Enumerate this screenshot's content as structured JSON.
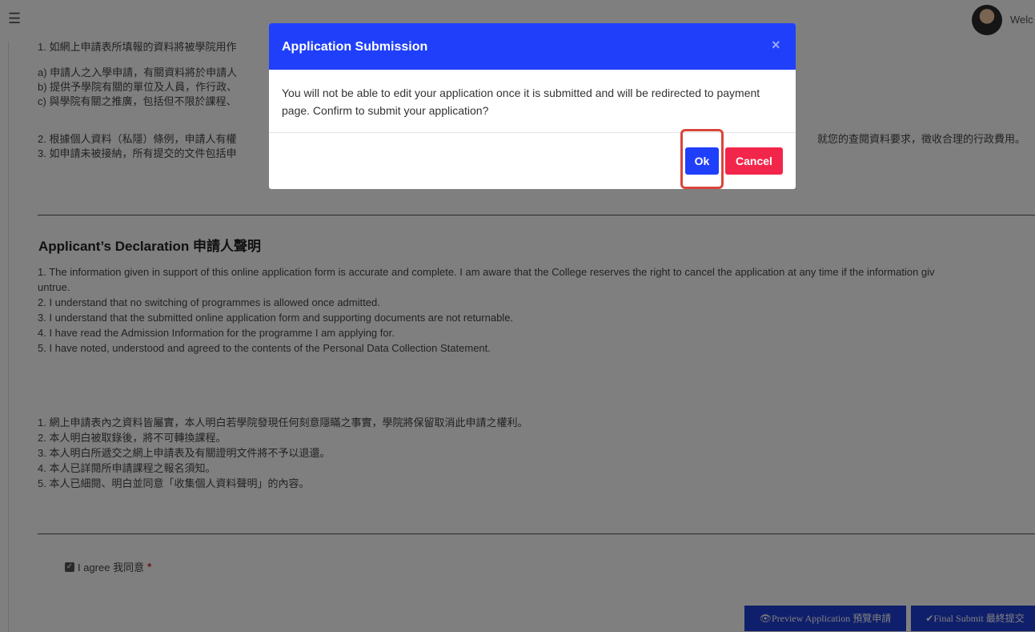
{
  "topbar": {
    "menu_icon": "hamburger-icon",
    "welcome_text": "Welc"
  },
  "pdcs": {
    "line1": "1. 如網上申請表所填報的資料將被學院用作",
    "line_a": "a) 申請人之入學申請，有關資料將於申請人",
    "line_b": "b) 提供予學院有關的單位及人員，作行政、",
    "line_c": "c) 與學院有關之推廣，包括但不限於課程、",
    "line2_left": "2. 根據個人資料（私隱）條例，申請人有權",
    "line2_right": "就您的查閱資料要求，徵收合理的行政費用。",
    "line3": "3. 如申請未被接納，所有提交的文件包括申"
  },
  "declaration": {
    "title": "Applicant’s Declaration 申請人聲明",
    "en_lines": [
      "1. The information given in support of this online application form is accurate and complete. I am aware that the College reserves the right to cancel the application at any time if the information giv",
      "untrue.",
      "2. I understand that no switching of programmes is allowed once admitted.",
      "3. I understand that the submitted online application form and supporting documents are not returnable.",
      "4. I have read the Admission Information for the programme I am applying for.",
      "5. I have noted, understood and agreed to the contents of the Personal Data Collection Statement."
    ],
    "zh_lines": [
      "1. 網上申請表內之資料皆屬實，本人明白若學院發現任何刻意隱瞞之事實，學院將保留取消此申請之權利。",
      "2. 本人明白被取錄後，將不可轉換課程。",
      "3. 本人明白所遞交之網上申請表及有關證明文件將不予以退還。",
      "4. 本人已詳閱所申請課程之報名須知。",
      "5. 本人已細閱、明白並同意「收集個人資料聲明」的內容。"
    ]
  },
  "agree": {
    "label": "I agree 我同意",
    "required_mark": "*",
    "checked": true
  },
  "actions": {
    "preview_label": "👁Preview Application 預覽申請",
    "final_label": "✔Final Submit 最終提交"
  },
  "modal": {
    "title": "Application Submission",
    "close_glyph": "×",
    "body": "You will not be able to edit your application once it is submitted and will be redirected to payment page. Confirm to submit your application?",
    "ok_label": "Ok",
    "cancel_label": "Cancel"
  },
  "colors": {
    "modal_header": "#1f3ffb",
    "ok_button": "#1f3ffb",
    "cancel_button": "#f2264b",
    "highlight": "#d9463a",
    "action_buttons": "#1f3fd6"
  }
}
